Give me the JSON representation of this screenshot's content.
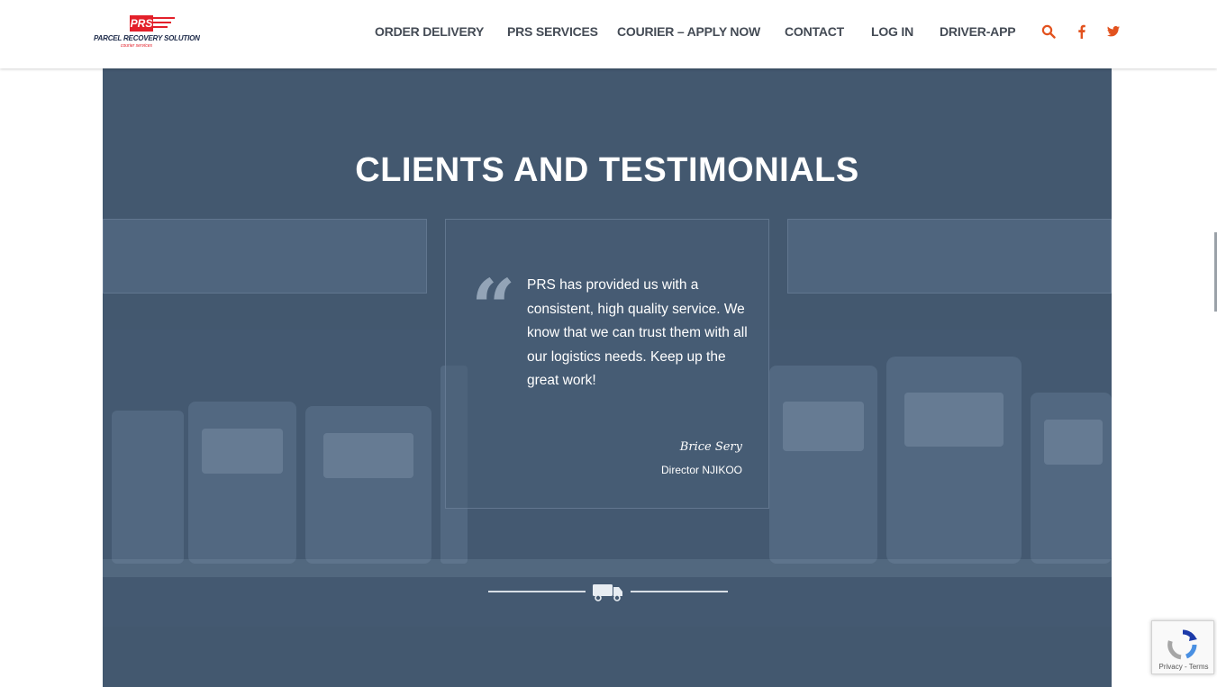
{
  "brand": {
    "logo_mark": "PRS",
    "logo_name": "PARCEL RECOVERY SOLUTION",
    "logo_tagline": "courier services",
    "accent_color": "#e3202a",
    "nav_color": "#444b55"
  },
  "nav": {
    "items": [
      {
        "label": "ORDER DELIVERY"
      },
      {
        "label": "PRS SERVICES"
      },
      {
        "label": "COURIER – APPLY NOW"
      },
      {
        "label": "CONTACT"
      },
      {
        "label": "LOG IN"
      },
      {
        "label": "DRIVER-APP"
      }
    ],
    "icons": [
      "search-icon",
      "facebook-icon",
      "twitter-icon"
    ],
    "icon_color": "#e2521e"
  },
  "section": {
    "title": "CLIENTS AND TESTIMONIALS",
    "background_color": "#43586f"
  },
  "testimonial": {
    "quote_glyph": "“",
    "text": "PRS has provided us with a consistent, high quality service. We know that we can trust them with all our logistics needs. Keep up the great work!",
    "author_name": "Brice Sery",
    "author_role": "Director NJIKOO"
  },
  "divider": {
    "icon": "delivery-van-icon"
  },
  "recaptcha": {
    "footer": "Privacy - Terms",
    "icon": "recaptcha-icon"
  }
}
